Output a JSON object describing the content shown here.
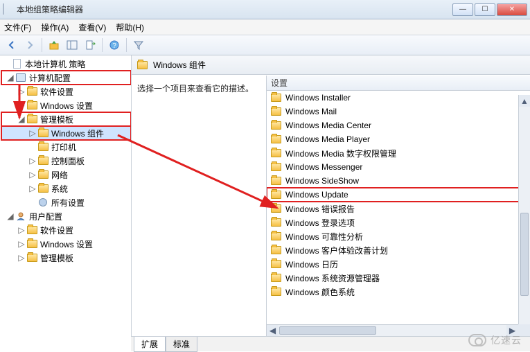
{
  "window": {
    "title": "本地组策略编辑器"
  },
  "menu": {
    "file": "文件(F)",
    "action": "操作(A)",
    "view": "查看(V)",
    "help": "帮助(H)"
  },
  "tree": {
    "root": "本地计算机 策略",
    "computer_config": "计算机配置",
    "software_settings": "软件设置",
    "windows_settings": "Windows 设置",
    "admin_templates": "管理模板",
    "windows_components": "Windows 组件",
    "printers": "打印机",
    "control_panel": "控制面板",
    "network": "网络",
    "system": "系统",
    "all_settings": "所有设置",
    "user_config": "用户配置",
    "u_software_settings": "软件设置",
    "u_windows_settings": "Windows 设置",
    "u_admin_templates": "管理模板"
  },
  "content": {
    "header": "Windows 组件",
    "desc": "选择一个项目来查看它的描述。",
    "column": "设置",
    "items": [
      "Windows Installer",
      "Windows Mail",
      "Windows Media Center",
      "Windows Media Player",
      "Windows Media 数字权限管理",
      "Windows Messenger",
      "Windows SideShow",
      "Windows Update",
      "Windows 错误报告",
      "Windows 登录选项",
      "Windows 可靠性分析",
      "Windows 客户体验改善计划",
      "Windows 日历",
      "Windows 系统资源管理器",
      "Windows 颜色系统"
    ]
  },
  "tabs": {
    "extended": "扩展",
    "standard": "标准"
  },
  "watermark": "亿速云"
}
